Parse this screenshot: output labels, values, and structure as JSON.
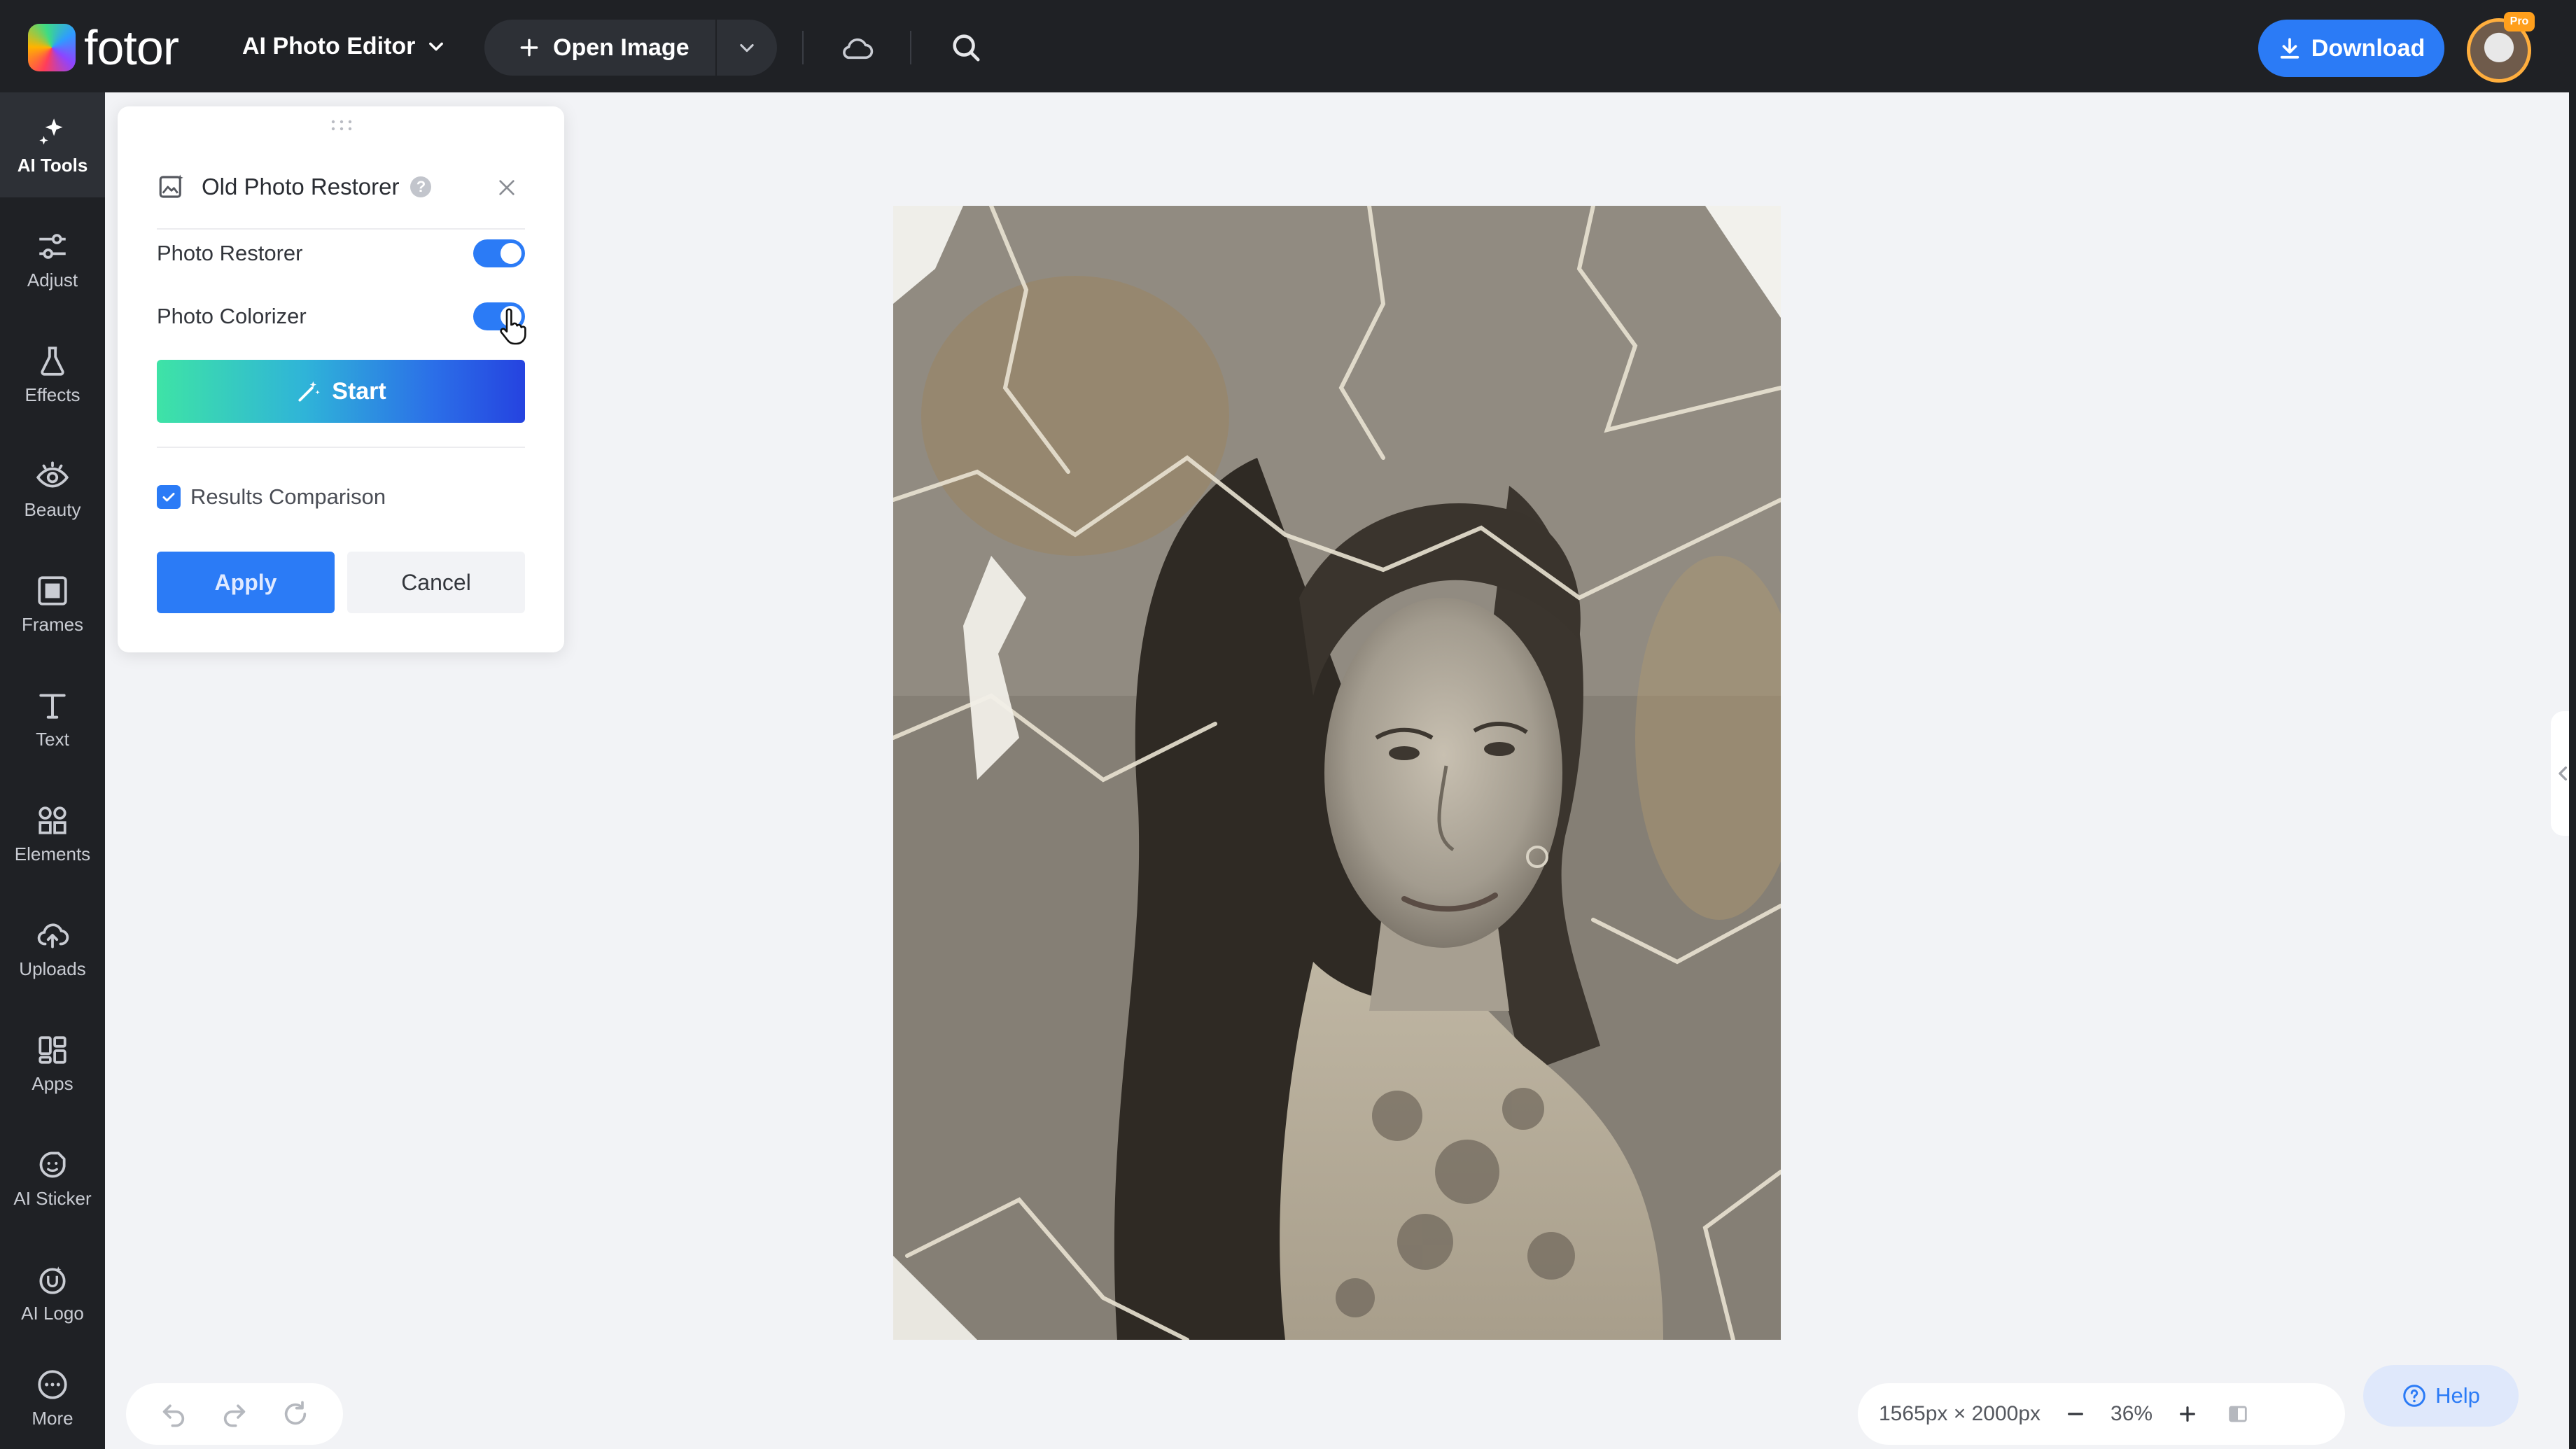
{
  "topbar": {
    "brand": "fotor",
    "editor_menu": "AI Photo Editor",
    "open_image": "Open Image",
    "download": "Download",
    "pro_badge": "Pro"
  },
  "rail": {
    "items": [
      {
        "label": "AI Tools",
        "icon": "sparkle-icon",
        "active": true
      },
      {
        "label": "Adjust",
        "icon": "sliders-icon"
      },
      {
        "label": "Effects",
        "icon": "flask-icon"
      },
      {
        "label": "Beauty",
        "icon": "eye-icon"
      },
      {
        "label": "Frames",
        "icon": "frame-icon"
      },
      {
        "label": "Text",
        "icon": "text-icon"
      },
      {
        "label": "Elements",
        "icon": "shapes-icon"
      },
      {
        "label": "Uploads",
        "icon": "cloud-upload-icon"
      },
      {
        "label": "Apps",
        "icon": "grid-icon"
      },
      {
        "label": "AI Sticker",
        "icon": "sticker-icon"
      },
      {
        "label": "AI Logo",
        "icon": "logo-icon"
      },
      {
        "label": "More",
        "icon": "more-icon"
      }
    ]
  },
  "panel": {
    "title": "Old Photo Restorer",
    "help": "?",
    "options": [
      {
        "label": "Photo Restorer",
        "enabled": true
      },
      {
        "label": "Photo Colorizer",
        "enabled": true
      }
    ],
    "start": "Start",
    "results_comparison": "Results Comparison",
    "results_comparison_checked": true,
    "apply": "Apply",
    "cancel": "Cancel"
  },
  "canvas": {
    "dimensions": "1565px × 2000px",
    "zoom": "36%"
  },
  "help_button": "Help",
  "colors": {
    "accent": "#2b7bf6",
    "topbar_bg": "#1f2125",
    "canvas_bg": "#f2f3f6"
  }
}
